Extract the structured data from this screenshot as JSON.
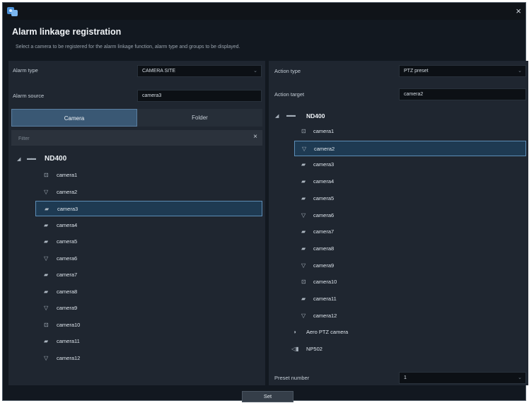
{
  "dialog": {
    "title": "Alarm linkage registration",
    "description": "Select a camera to be registered for the alarm linkage function, alarm type and groups to be displayed.",
    "set_label": "Set",
    "close_glyph": "×"
  },
  "left": {
    "alarm_type": {
      "label": "Alarm type",
      "value": "CAMERA SITE"
    },
    "alarm_source": {
      "label": "Alarm source",
      "value": "camera3"
    },
    "tabs": [
      {
        "label": "Camera",
        "active": true
      },
      {
        "label": "Folder",
        "active": false
      }
    ],
    "filter": {
      "placeholder": "Filter",
      "clear": "×"
    },
    "tree": {
      "root": "ND400",
      "items": [
        {
          "label": "camera1",
          "icon": "box-camera-icon",
          "selected": false
        },
        {
          "label": "camera2",
          "icon": "dome-camera-icon",
          "selected": false
        },
        {
          "label": "camera3",
          "icon": "bullet-camera-icon",
          "selected": true
        },
        {
          "label": "camera4",
          "icon": "bullet-camera-icon",
          "selected": false
        },
        {
          "label": "camera5",
          "icon": "bullet-camera-icon",
          "selected": false
        },
        {
          "label": "camera6",
          "icon": "dome-camera-icon",
          "selected": false
        },
        {
          "label": "camera7",
          "icon": "bullet-camera-icon",
          "selected": false
        },
        {
          "label": "camera8",
          "icon": "bullet-camera-icon",
          "selected": false
        },
        {
          "label": "camera9",
          "icon": "dome-camera-icon",
          "selected": false
        },
        {
          "label": "camera10",
          "icon": "box-camera-icon",
          "selected": false
        },
        {
          "label": "camera11",
          "icon": "bullet-camera-icon",
          "selected": false
        },
        {
          "label": "camera12",
          "icon": "dome-camera-icon",
          "selected": false
        }
      ]
    }
  },
  "right": {
    "action_type": {
      "label": "Action type",
      "value": "PTZ preset"
    },
    "action_target": {
      "label": "Action target",
      "value": "camera2"
    },
    "tree": {
      "root": "ND400",
      "items": [
        {
          "label": "camera1",
          "icon": "box-camera-icon",
          "selected": false
        },
        {
          "label": "camera2",
          "icon": "dome-camera-icon",
          "selected": true
        },
        {
          "label": "camera3",
          "icon": "bullet-camera-icon",
          "selected": false
        },
        {
          "label": "camera4",
          "icon": "bullet-camera-icon",
          "selected": false
        },
        {
          "label": "camera5",
          "icon": "bullet-camera-icon",
          "selected": false
        },
        {
          "label": "camera6",
          "icon": "dome-camera-icon",
          "selected": false
        },
        {
          "label": "camera7",
          "icon": "bullet-camera-icon",
          "selected": false
        },
        {
          "label": "camera8",
          "icon": "bullet-camera-icon",
          "selected": false
        },
        {
          "label": "camera9",
          "icon": "dome-camera-icon",
          "selected": false
        },
        {
          "label": "camera10",
          "icon": "box-camera-icon",
          "selected": false
        },
        {
          "label": "camera11",
          "icon": "bullet-camera-icon",
          "selected": false
        },
        {
          "label": "camera12",
          "icon": "dome-camera-icon",
          "selected": false
        }
      ],
      "extra_items": [
        {
          "label": "Aero PTZ camera",
          "icon": "aero-ptz-icon"
        },
        {
          "label": "NP502",
          "icon": "encoder-icon"
        }
      ]
    },
    "preset_number": {
      "label": "Preset number",
      "value": "1"
    }
  },
  "colors": {
    "accent": "#5d8db6",
    "background": "#121820",
    "panel": "#1f2630",
    "selected_fill": "#1e3a52"
  }
}
